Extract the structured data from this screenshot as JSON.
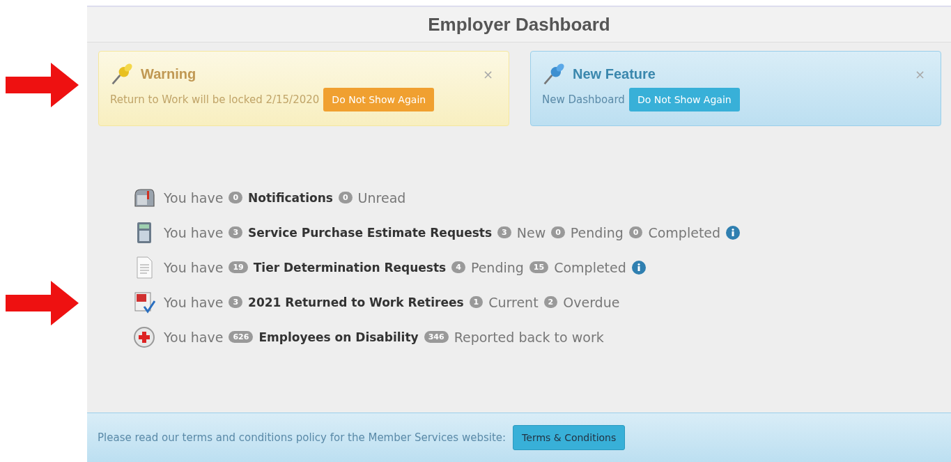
{
  "header": {
    "title": "Employer Dashboard"
  },
  "alerts": [
    {
      "kind": "warning",
      "title": "Warning",
      "message": "Return to Work will be locked 2/15/2020",
      "button": "Do Not Show Again",
      "close": "×"
    },
    {
      "kind": "info",
      "title": "New Feature",
      "message": "New Dashboard",
      "button": "Do Not Show Again",
      "close": "×"
    }
  ],
  "rows": [
    {
      "kind": "mailbox",
      "parts": [
        {
          "kind": "text",
          "text": "You have"
        },
        {
          "kind": "badge",
          "text": "0"
        },
        {
          "kind": "bold",
          "text": "Notifications"
        },
        {
          "kind": "badge",
          "text": "0"
        },
        {
          "kind": "text",
          "text": "Unread"
        }
      ]
    },
    {
      "kind": "calculator",
      "parts": [
        {
          "kind": "text",
          "text": "You have"
        },
        {
          "kind": "badge",
          "text": "3"
        },
        {
          "kind": "bold",
          "text": "Service Purchase Estimate Requests"
        },
        {
          "kind": "badge",
          "text": "3"
        },
        {
          "kind": "text",
          "text": "New"
        },
        {
          "kind": "badge",
          "text": "0"
        },
        {
          "kind": "text",
          "text": "Pending"
        },
        {
          "kind": "badge",
          "text": "0"
        },
        {
          "kind": "text",
          "text": "Completed"
        },
        {
          "kind": "info"
        }
      ]
    },
    {
      "kind": "document",
      "parts": [
        {
          "kind": "text",
          "text": "You have"
        },
        {
          "kind": "badge",
          "text": "19"
        },
        {
          "kind": "bold",
          "text": "Tier Determination Requests"
        },
        {
          "kind": "badge",
          "text": "4"
        },
        {
          "kind": "text",
          "text": "Pending"
        },
        {
          "kind": "badge",
          "text": "15"
        },
        {
          "kind": "text",
          "text": "Completed"
        },
        {
          "kind": "info"
        }
      ]
    },
    {
      "kind": "calendar",
      "parts": [
        {
          "kind": "text",
          "text": "You have"
        },
        {
          "kind": "badge",
          "text": "3"
        },
        {
          "kind": "bold",
          "text": "2021 Returned to Work Retirees"
        },
        {
          "kind": "badge",
          "text": "1"
        },
        {
          "kind": "text",
          "text": "Current"
        },
        {
          "kind": "badge",
          "text": "2"
        },
        {
          "kind": "text",
          "text": "Overdue"
        }
      ]
    },
    {
      "kind": "medical",
      "parts": [
        {
          "kind": "text",
          "text": "You have"
        },
        {
          "kind": "badge",
          "text": "626"
        },
        {
          "kind": "bold",
          "text": "Employees on Disability"
        },
        {
          "kind": "badge",
          "text": "346"
        },
        {
          "kind": "text",
          "text": "Reported back to work"
        }
      ]
    }
  ],
  "footer": {
    "message": "Please read our terms and conditions policy for the Member Services website:",
    "button": "Terms & Conditions"
  }
}
